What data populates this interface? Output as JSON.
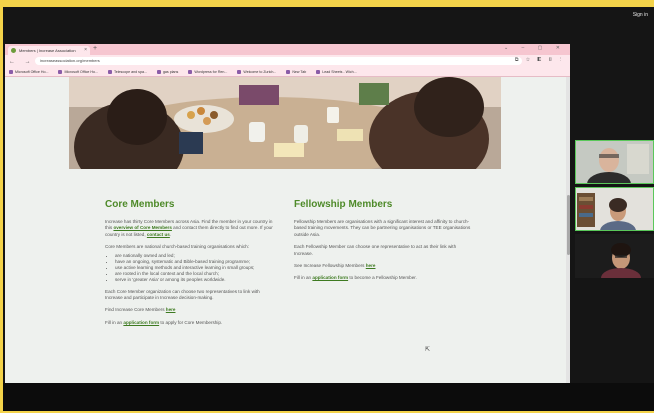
{
  "meeting": {
    "signin_label": "Sign in"
  },
  "browser": {
    "tab_title": "Members | Increase Association",
    "url": "increaseassociation.org/members",
    "bookmarks": [
      "Microsoft Office Ho...",
      "Microsoft Office Ho...",
      "Telescope and spa...",
      "gas plans",
      "Wordpress for Ren...",
      "Welcome to Zurich...",
      "New Tab",
      "Lead Sheets - Wich..."
    ]
  },
  "core": {
    "heading": "Core Members",
    "intro_before": "Increase has thirty Core Members across Asia. Find the member in your country in this ",
    "intro_link1": "overview of Core Members",
    "intro_mid": " and contact them directly to find out more. If your country is not listed, ",
    "intro_link2": "contact us",
    "intro_end": ".",
    "list_intro": "Core Members are national church-based training organisations which:",
    "bullets": [
      "are nationally owned and led;",
      "have an ongoing, systematic and Bible-based training programme;",
      "use active learning methods and interactive learning in small groups;",
      "are rooted in the local context and the local church;",
      "serve in 'greater Asia' or among its peoples worldwide."
    ],
    "rep_text": "Each Core Member organization can choose two representatives to link with Increase and participate in Increase decision-making.",
    "find_before": "Find Increase Core Members ",
    "find_link": "here",
    "fill_before": "Fill in an ",
    "fill_link": "application form",
    "fill_after": " to apply for Core Membership."
  },
  "fellowship": {
    "heading": "Fellowship Members",
    "intro": "Fellowship Members are organisations with a significant interest and affinity to church-based training movements. They can be partnering organisations or TEE organisations outside Asia.",
    "rep_text": "Each Fellowship Member can choose one representative to act as their link with Increase.",
    "see_before": "See Increase Fellowship Members ",
    "see_link": "here",
    "fill_before": "Fill in an ",
    "fill_link": "application form",
    "fill_after": " to become a Fellowship Member."
  },
  "colors": {
    "accent_green": "#4e8a29",
    "frame_yellow": "#f4d34a",
    "tab_pink": "#f6c6d0"
  }
}
